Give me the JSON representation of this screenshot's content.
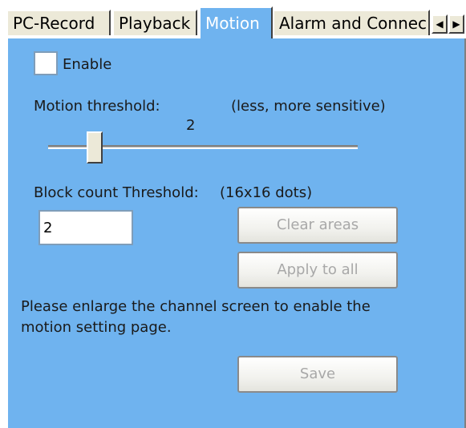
{
  "tabs": [
    {
      "label": "PC-Record",
      "active": false
    },
    {
      "label": "Playback",
      "active": false
    },
    {
      "label": "Motion",
      "active": true
    },
    {
      "label": "Alarm and Connec",
      "active": false
    }
  ],
  "tab_scroll": {
    "left": "◀",
    "right": "▶"
  },
  "motion": {
    "enable_label": "Enable",
    "enable_checked": false,
    "threshold_label": "Motion threshold:",
    "threshold_hint": "(less, more sensitive)",
    "threshold_value": "2",
    "block_label": "Block count Threshold:",
    "block_hint": "(16x16 dots)",
    "block_value": "2",
    "clear_button": "Clear areas",
    "apply_button": "Apply to all",
    "message_line1": "Please enlarge the channel screen to enable the",
    "message_line2": "motion setting page.",
    "save_button": "Save"
  },
  "colors": {
    "panel_bg": "#6fb3ef",
    "tab_bg": "#ece9d8",
    "disabled_text": "#a8a8a8"
  }
}
